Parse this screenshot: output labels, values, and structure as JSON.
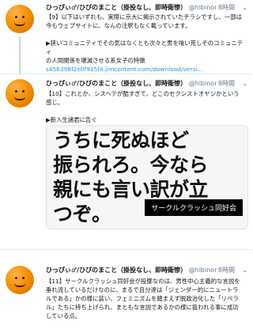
{
  "tweets": [
    {
      "name": "ひっぴぃ♂/ひびのまこと（掛投なし、即時衛惨）",
      "handle": "@hibinom…",
      "time": "8時間",
      "lines": [
        "【9】以下はいずれも、実際に京大に掲示されていたチラシですし、一部は",
        "今もウェブサイトに、なんの注釈もなく載っています。",
        "",
        "▶狭いコミュニティでその気はなくとも次々と男を喰い荒しそのコミュニティ",
        "の人間関係を壊滅させる系女子の特徴"
      ],
      "link": "s456398f2e0f915f4.jimcontent.com/download/versi…"
    },
    {
      "name": "ひっぴぃ♂/ひびのまこと（掛投なし、即時衛惨）",
      "handle": "@hibinom…",
      "time": "8時間",
      "lines": [
        "【10】これとか、シスヘテが酷すぎて、どこのセクシストオヤジかという",
        "感じ。",
        "",
        "▶新入生諸君に告ぐ"
      ],
      "media": {
        "lines": [
          "うちに死ぬほど",
          "振られろ。今なら",
          "親にも言い訳が立",
          "つぞ。"
        ],
        "badge": "サークルクラッシュ同好会"
      }
    },
    {
      "name": "ひっぴぃ♂/ひびのまこと（掛投なし、即時衛惨）",
      "handle": "@hibinom…",
      "time": "8時間",
      "lines": [
        "【11】サークルクラッシュ同好会が投擲なのは、男性中心主義的な言説を",
        "垂れ流しているだけなのに、まるで自分達は「ジェンダー的にニュートラ",
        "ルである」かの様に装い、フェミニズムを踏まえず脱政治化した「リベラ",
        "ル」たちに持ち上げられ、まともな言説であるかの様に扱われる事に成功",
        "している点。"
      ]
    }
  ]
}
